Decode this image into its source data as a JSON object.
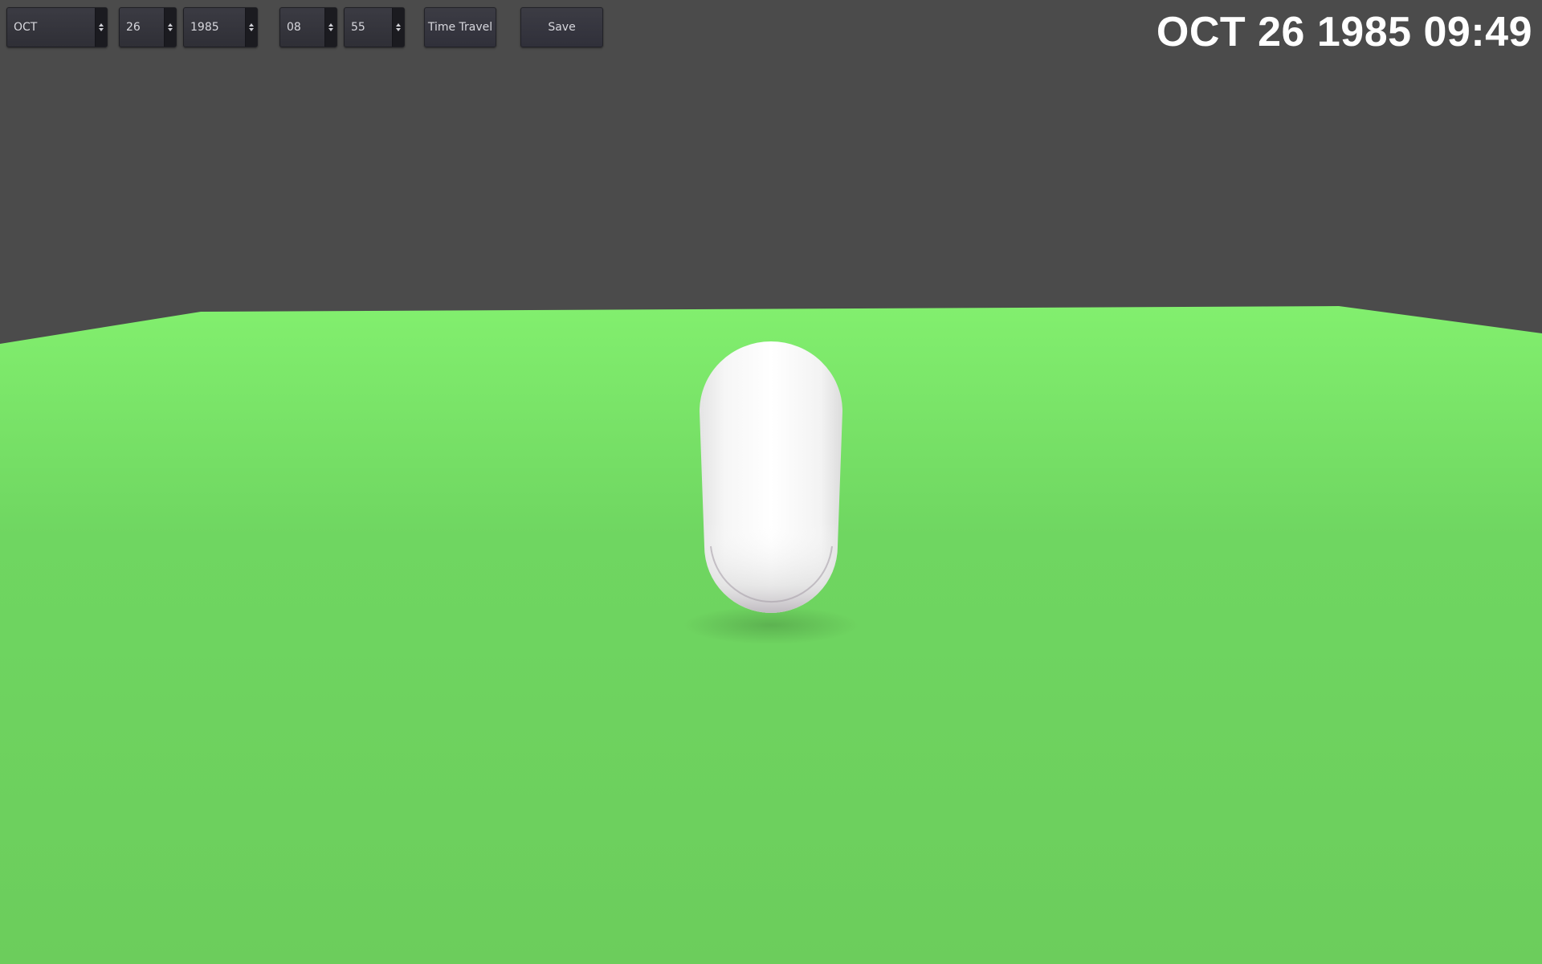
{
  "toolbar": {
    "month": "OCT",
    "day": "26",
    "year": "1985",
    "hour": "08",
    "minute": "55",
    "time_travel_label": "Time Travel",
    "save_label": "Save"
  },
  "clock": {
    "display": "OCT 26 1985 09:49"
  },
  "scene": {
    "sky_color": "#4b4b4b",
    "ground_color": "#6fd160",
    "capsule_color": "#ffffff"
  }
}
